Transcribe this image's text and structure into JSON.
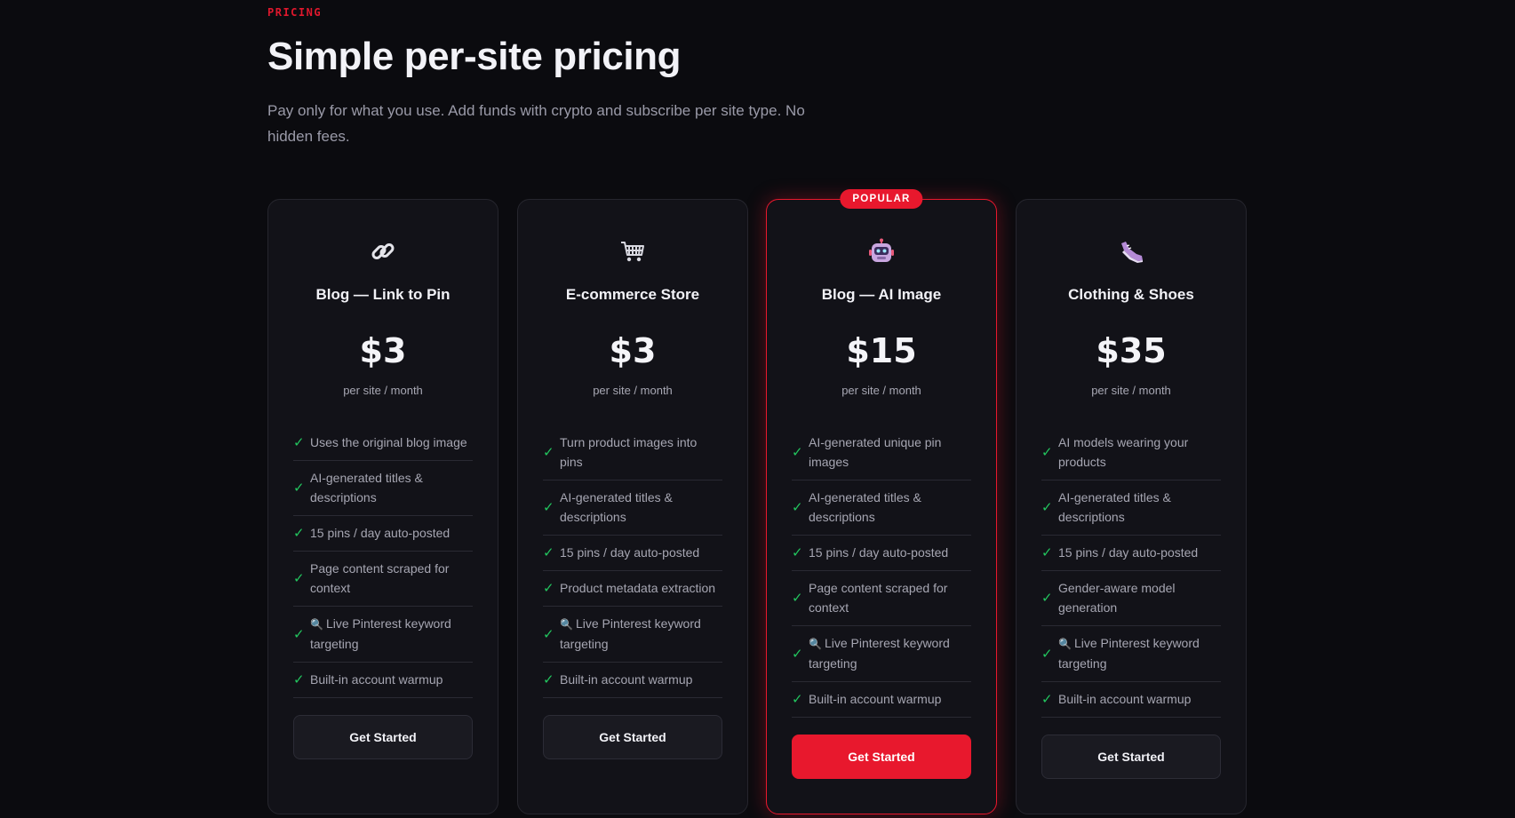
{
  "header": {
    "eyebrow": "PRICING",
    "title": "Simple per-site pricing",
    "subtitle": "Pay only for what you use. Add funds with crypto and subscribe per site type. No hidden fees."
  },
  "plans": [
    {
      "icon": "link-icon",
      "name": "Blog — Link to Pin",
      "price": "$3",
      "period": "per site / month",
      "popular": false,
      "features": [
        "Uses the original blog image",
        "AI-generated titles & descriptions",
        "15 pins / day auto-posted",
        "Page content scraped for context",
        "Live Pinterest keyword targeting",
        "Built-in account warmup"
      ],
      "cta": "Get Started"
    },
    {
      "icon": "shopping-cart-icon",
      "name": "E-commerce Store",
      "price": "$3",
      "period": "per site / month",
      "popular": false,
      "features": [
        "Turn product images into pins",
        "AI-generated titles & descriptions",
        "15 pins / day auto-posted",
        "Product metadata extraction",
        "Live Pinterest keyword targeting",
        "Built-in account warmup"
      ],
      "cta": "Get Started"
    },
    {
      "icon": "robot-icon",
      "name": "Blog — AI Image",
      "price": "$15",
      "period": "per site / month",
      "popular": true,
      "badge": "POPULAR",
      "features": [
        "AI-generated unique pin images",
        "AI-generated titles & descriptions",
        "15 pins / day auto-posted",
        "Page content scraped for context",
        "Live Pinterest keyword targeting",
        "Built-in account warmup"
      ],
      "cta": "Get Started"
    },
    {
      "icon": "sneaker-icon",
      "name": "Clothing & Shoes",
      "price": "$35",
      "period": "per site / month",
      "popular": false,
      "features": [
        "AI models wearing your products",
        "AI-generated titles & descriptions",
        "15 pins / day auto-posted",
        "Gender-aware model generation",
        "Live Pinterest keyword targeting",
        "Built-in account warmup"
      ],
      "cta": "Get Started"
    }
  ],
  "colors": {
    "background": "#0b0b0f",
    "card": "#121218",
    "accent": "#e8182d",
    "check": "#22c55e"
  }
}
